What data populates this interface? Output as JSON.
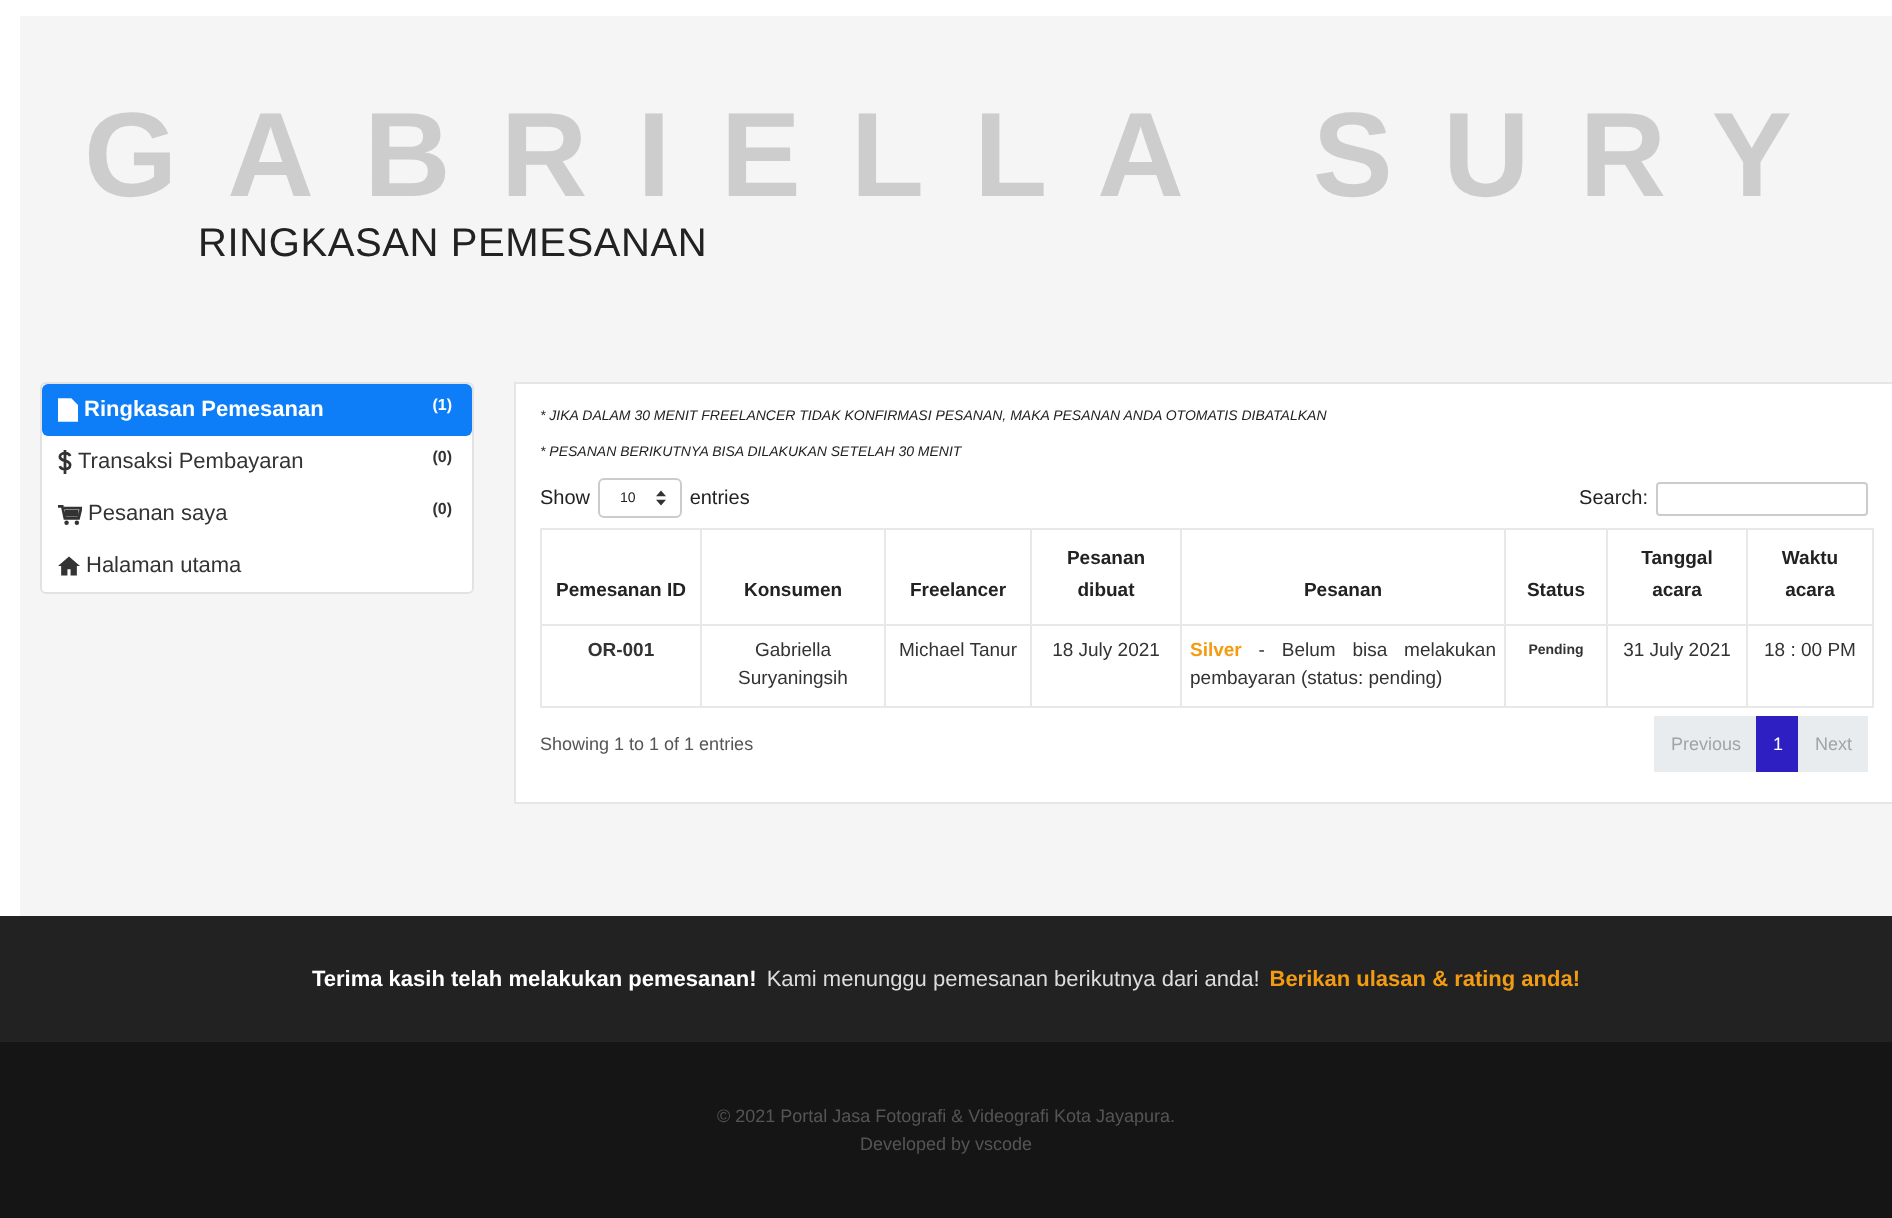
{
  "header": {
    "background_text": "GABRIELLA SURY",
    "title": "RINGKASAN PEMESANAN"
  },
  "sidebar": {
    "items": [
      {
        "label": "Ringkasan Pemesanan",
        "count": "(1)",
        "selected": true
      },
      {
        "label": "Transaksi Pembayaran",
        "count": "(0)",
        "selected": false
      },
      {
        "label": "Pesanan saya",
        "count": "(0)",
        "selected": false
      },
      {
        "label": "Halaman utama",
        "selected": false
      }
    ]
  },
  "notes": [
    "* JIKA DALAM 30 MENIT FREELANCER TIDAK KONFIRMASI PESANAN, MAKA PESANAN ANDA OTOMATIS DIBATALKAN",
    "* PESANAN BERIKUTNYA BISA DILAKUKAN SETELAH 30 MENIT"
  ],
  "table_controls": {
    "show_label": "Show",
    "page_size": "10",
    "entries_label": "entries",
    "search_label": "Search:"
  },
  "table": {
    "columns": [
      "Pemesanan ID",
      "Konsumen",
      "Freelancer",
      "Pesanan dibuat",
      "Pesanan",
      "Status",
      "Tanggal acara",
      "Waktu acara"
    ],
    "rows": [
      {
        "id": "OR-001",
        "konsumen": "Gabriella Suryaningsih",
        "freelancer": "Michael Tanur",
        "dibuat": "18 July 2021",
        "pesanan": "**Silver** - Belum bisa melakukan pembayaran (status: pending)",
        "status": "Pending",
        "tanggal": "31 July 2021",
        "waktu": "18 : 00 PM"
      }
    ]
  },
  "table_info": "Showing 1 to 1 of 1 entries",
  "pagination": [
    {
      "label": "Previous",
      "disabled": true,
      "selected": false
    },
    {
      "label": "1",
      "disabled": false,
      "selected": true
    },
    {
      "label": "Next",
      "disabled": true,
      "selected": false
    }
  ],
  "footer": {
    "thanks": "Terima kasih telah melakukan pemesanan!",
    "message": "Kami menunggu pemesanan berikutnya dari anda!",
    "link": "Berikan ulasan & rating anda!",
    "copyright": "© 2021 Portal Jasa Fotografi & Videografi Kota Jayapura.",
    "developed": "Developed by vscode"
  }
}
